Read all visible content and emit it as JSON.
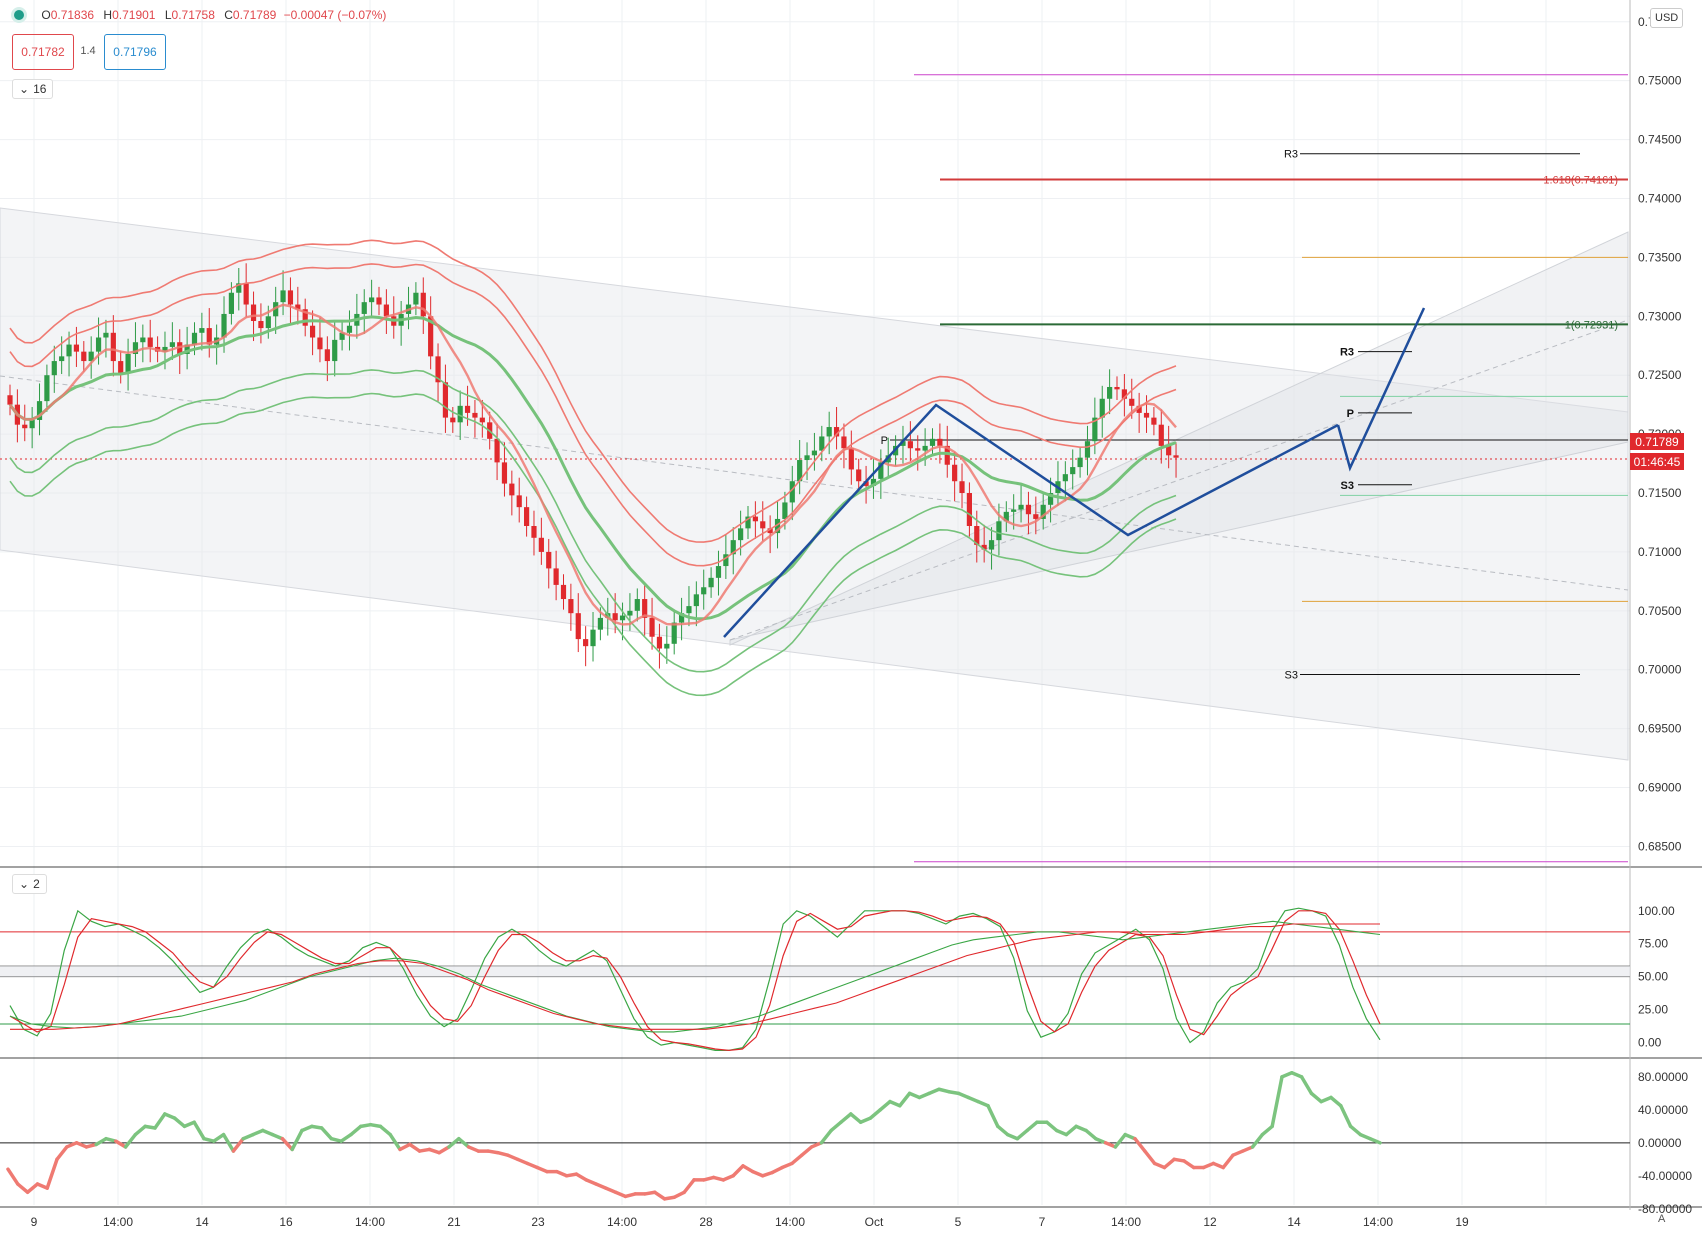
{
  "ohlc": {
    "open_label": "O",
    "open": "0.71836",
    "high_label": "H",
    "high": "0.71901",
    "low_label": "L",
    "low": "0.71758",
    "close_label": "C",
    "close": "0.71789",
    "change": "−0.00047 (−0.07%)"
  },
  "trade": {
    "sell": "0.71782",
    "spread": "1.4",
    "buy": "0.71796"
  },
  "panes": {
    "main_collapse": "16",
    "osc_collapse": "2"
  },
  "currency": "USD",
  "last_price": "0.71789",
  "countdown": "01:46:45",
  "auto_label": "A",
  "colors": {
    "bull": "#2e9b47",
    "bear": "#e0292d",
    "band_red": "#ef7a72",
    "band_green": "#76c27b",
    "pattern": "#1f4e9c"
  },
  "chart_data": [
    {
      "type": "candlestick",
      "currency": "USD",
      "ylim": [
        0.683,
        0.756
      ],
      "y_ticks": [
        "0.75500",
        "0.75000",
        "0.74500",
        "0.74000",
        "0.73500",
        "0.73000",
        "0.72500",
        "0.72000",
        "0.71500",
        "0.71000",
        "0.70500",
        "0.70000",
        "0.69500",
        "0.69000",
        "0.68500"
      ],
      "x_ticks": [
        "9",
        "14:00",
        "14",
        "16",
        "14:00",
        "21",
        "23",
        "14:00",
        "28",
        "14:00",
        "Oct",
        "5",
        "7",
        "14:00",
        "12",
        "14",
        "14:00",
        "19"
      ],
      "candle_closes": [
        0.7225,
        0.7208,
        0.7205,
        0.7212,
        0.7228,
        0.725,
        0.7262,
        0.7266,
        0.7276,
        0.727,
        0.7262,
        0.727,
        0.7282,
        0.7286,
        0.7262,
        0.7252,
        0.7268,
        0.7278,
        0.7282,
        0.7274,
        0.727,
        0.7274,
        0.7278,
        0.7268,
        0.7276,
        0.7286,
        0.729,
        0.7276,
        0.7282,
        0.7302,
        0.732,
        0.7328,
        0.731,
        0.7296,
        0.729,
        0.73,
        0.7312,
        0.7322,
        0.731,
        0.7306,
        0.7292,
        0.7282,
        0.7272,
        0.7262,
        0.728,
        0.7286,
        0.7292,
        0.7302,
        0.7312,
        0.7316,
        0.731,
        0.73,
        0.7292,
        0.7302,
        0.731,
        0.732,
        0.73,
        0.7266,
        0.7244,
        0.7214,
        0.721,
        0.7224,
        0.7218,
        0.7214,
        0.721,
        0.7196,
        0.7176,
        0.7158,
        0.7148,
        0.7138,
        0.7122,
        0.7112,
        0.71,
        0.7086,
        0.7072,
        0.706,
        0.7048,
        0.7026,
        0.702,
        0.7034,
        0.7044,
        0.7048,
        0.7042,
        0.7046,
        0.705,
        0.706,
        0.7044,
        0.7028,
        0.7018,
        0.7022,
        0.704,
        0.7048,
        0.7054,
        0.7064,
        0.707,
        0.7078,
        0.7088,
        0.7098,
        0.711,
        0.712,
        0.713,
        0.7126,
        0.712,
        0.7116,
        0.7128,
        0.7142,
        0.716,
        0.7178,
        0.7182,
        0.7186,
        0.7198,
        0.7206,
        0.7198,
        0.7188,
        0.717,
        0.716,
        0.7156,
        0.7162,
        0.7176,
        0.7182,
        0.719,
        0.7194,
        0.7188,
        0.7186,
        0.719,
        0.7196,
        0.719,
        0.7174,
        0.716,
        0.715,
        0.7122,
        0.7106,
        0.7102,
        0.711,
        0.7126,
        0.7134,
        0.7136,
        0.714,
        0.7132,
        0.7128,
        0.714,
        0.715,
        0.716,
        0.7166,
        0.7172,
        0.718,
        0.7194,
        0.7214,
        0.723,
        0.724,
        0.7238,
        0.723,
        0.7224,
        0.7218,
        0.7214,
        0.7208,
        0.719,
        0.7182,
        0.718
      ],
      "fib_levels": [
        {
          "label": "1.618(0.74161)",
          "value": 0.74161
        },
        {
          "label": "1(0.72931)",
          "value": 0.72931
        }
      ],
      "pivot_labels": [
        "R3",
        "P",
        "S3"
      ],
      "pivot_levels_near": [
        {
          "label": "R3",
          "value": 0.727
        },
        {
          "label": "P",
          "value": 0.7218
        },
        {
          "label": "S3",
          "value": 0.7157
        }
      ],
      "pivot_levels_far": [
        {
          "label": "R3",
          "value": 0.7438
        },
        {
          "label": "P",
          "value": 0.7195
        },
        {
          "label": "S3",
          "value": 0.6996
        }
      ],
      "hlines": [
        0.7505,
        0.735,
        0.7232,
        0.7148,
        0.7058,
        0.6837
      ],
      "current_price": 0.71789
    },
    {
      "type": "line",
      "name": "stochastic",
      "ylim": [
        -8,
        112
      ],
      "y_ticks": [
        "100.00",
        "75.00",
        "50.00",
        "25.00",
        "0.00"
      ],
      "levels": [
        84,
        58,
        50,
        14
      ],
      "k_values": [
        28,
        10,
        5,
        22,
        70,
        100,
        92,
        88,
        90,
        85,
        80,
        72,
        62,
        50,
        38,
        42,
        58,
        72,
        82,
        86,
        80,
        72,
        66,
        62,
        58,
        62,
        72,
        76,
        72,
        56,
        36,
        20,
        12,
        18,
        40,
        64,
        80,
        86,
        80,
        70,
        62,
        58,
        64,
        70,
        62,
        40,
        18,
        4,
        -2,
        0,
        -2,
        -4,
        -6,
        -6,
        -4,
        10,
        48,
        90,
        100,
        96,
        88,
        80,
        90,
        100,
        100,
        100,
        100,
        98,
        94,
        90,
        96,
        98,
        94,
        88,
        64,
        24,
        4,
        8,
        22,
        52,
        68,
        74,
        80,
        86,
        78,
        56,
        18,
        0,
        8,
        30,
        42,
        46,
        56,
        84,
        100,
        102,
        100,
        96,
        74,
        42,
        18,
        2
      ],
      "d_values": [
        20,
        14,
        8,
        12,
        44,
        80,
        94,
        92,
        90,
        88,
        84,
        76,
        68,
        56,
        46,
        42,
        50,
        64,
        76,
        84,
        82,
        76,
        70,
        64,
        60,
        60,
        66,
        72,
        72,
        62,
        44,
        28,
        18,
        16,
        28,
        50,
        70,
        82,
        82,
        76,
        68,
        62,
        62,
        66,
        64,
        50,
        30,
        12,
        2,
        0,
        -1,
        -3,
        -5,
        -6,
        -5,
        4,
        28,
        66,
        92,
        98,
        92,
        86,
        88,
        96,
        98,
        100,
        100,
        99,
        96,
        92,
        94,
        96,
        95,
        90,
        76,
        44,
        16,
        8,
        14,
        38,
        58,
        70,
        76,
        82,
        80,
        66,
        36,
        10,
        6,
        20,
        36,
        44,
        50,
        70,
        92,
        100,
        100,
        98,
        86,
        62,
        36,
        14
      ],
      "k_slow": [
        20,
        14,
        12,
        11,
        12,
        14,
        16,
        18,
        20,
        24,
        28,
        32,
        38,
        44,
        50,
        54,
        58,
        62,
        64,
        62,
        58,
        52,
        44,
        38,
        32,
        26,
        20,
        16,
        12,
        10,
        8,
        8,
        10,
        12,
        16,
        20,
        26,
        32,
        38,
        44,
        50,
        56,
        62,
        68,
        74,
        78,
        80,
        82,
        84,
        84,
        82,
        80,
        78,
        80,
        82,
        84,
        86,
        88,
        90,
        92,
        90,
        88,
        86,
        84,
        82
      ],
      "d_slow": [
        10,
        10,
        10,
        11,
        12,
        14,
        18,
        22,
        26,
        30,
        34,
        38,
        42,
        46,
        52,
        56,
        60,
        62,
        62,
        60,
        54,
        48,
        40,
        34,
        28,
        22,
        18,
        14,
        12,
        10,
        10,
        10,
        10,
        12,
        14,
        18,
        22,
        26,
        30,
        36,
        42,
        48,
        54,
        60,
        66,
        70,
        74,
        78,
        80,
        82,
        84,
        84,
        82,
        82,
        82,
        84,
        86,
        88,
        88,
        90,
        90,
        90,
        90,
        90
      ]
    },
    {
      "type": "line",
      "name": "momentum",
      "ylim": [
        -90,
        92
      ],
      "y_ticks": [
        "80.00000",
        "40.00000",
        "0.00000",
        "-40.00000",
        "-80.00000"
      ],
      "zero_line": 0,
      "values": [
        -32,
        -50,
        -60,
        -50,
        -55,
        -20,
        -5,
        0,
        -5,
        -2,
        5,
        2,
        -5,
        10,
        20,
        18,
        35,
        30,
        20,
        25,
        5,
        2,
        10,
        -10,
        5,
        10,
        15,
        10,
        5,
        -8,
        15,
        20,
        18,
        5,
        2,
        10,
        20,
        22,
        20,
        10,
        -8,
        -2,
        -10,
        -8,
        -12,
        -5,
        5,
        -5,
        -10,
        -10,
        -12,
        -15,
        -20,
        -25,
        -30,
        -35,
        -35,
        -40,
        -38,
        -45,
        -50,
        -55,
        -60,
        -65,
        -62,
        -62,
        -60,
        -68,
        -66,
        -60,
        -45,
        -45,
        -42,
        -45,
        -40,
        -28,
        -35,
        -40,
        -36,
        -30,
        -25,
        -15,
        -5,
        0,
        15,
        25,
        35,
        25,
        30,
        40,
        50,
        45,
        60,
        55,
        60,
        65,
        62,
        60,
        55,
        50,
        45,
        20,
        10,
        5,
        15,
        25,
        25,
        15,
        10,
        20,
        15,
        5,
        0,
        -5,
        10,
        5,
        -10,
        -25,
        -30,
        -20,
        -22,
        -30,
        -30,
        -25,
        -30,
        -15,
        -10,
        -5,
        10,
        20,
        80,
        85,
        80,
        60,
        50,
        55,
        45,
        20,
        10,
        5,
        0
      ],
      "thresholds": {
        "bull_above": 0
      }
    }
  ]
}
